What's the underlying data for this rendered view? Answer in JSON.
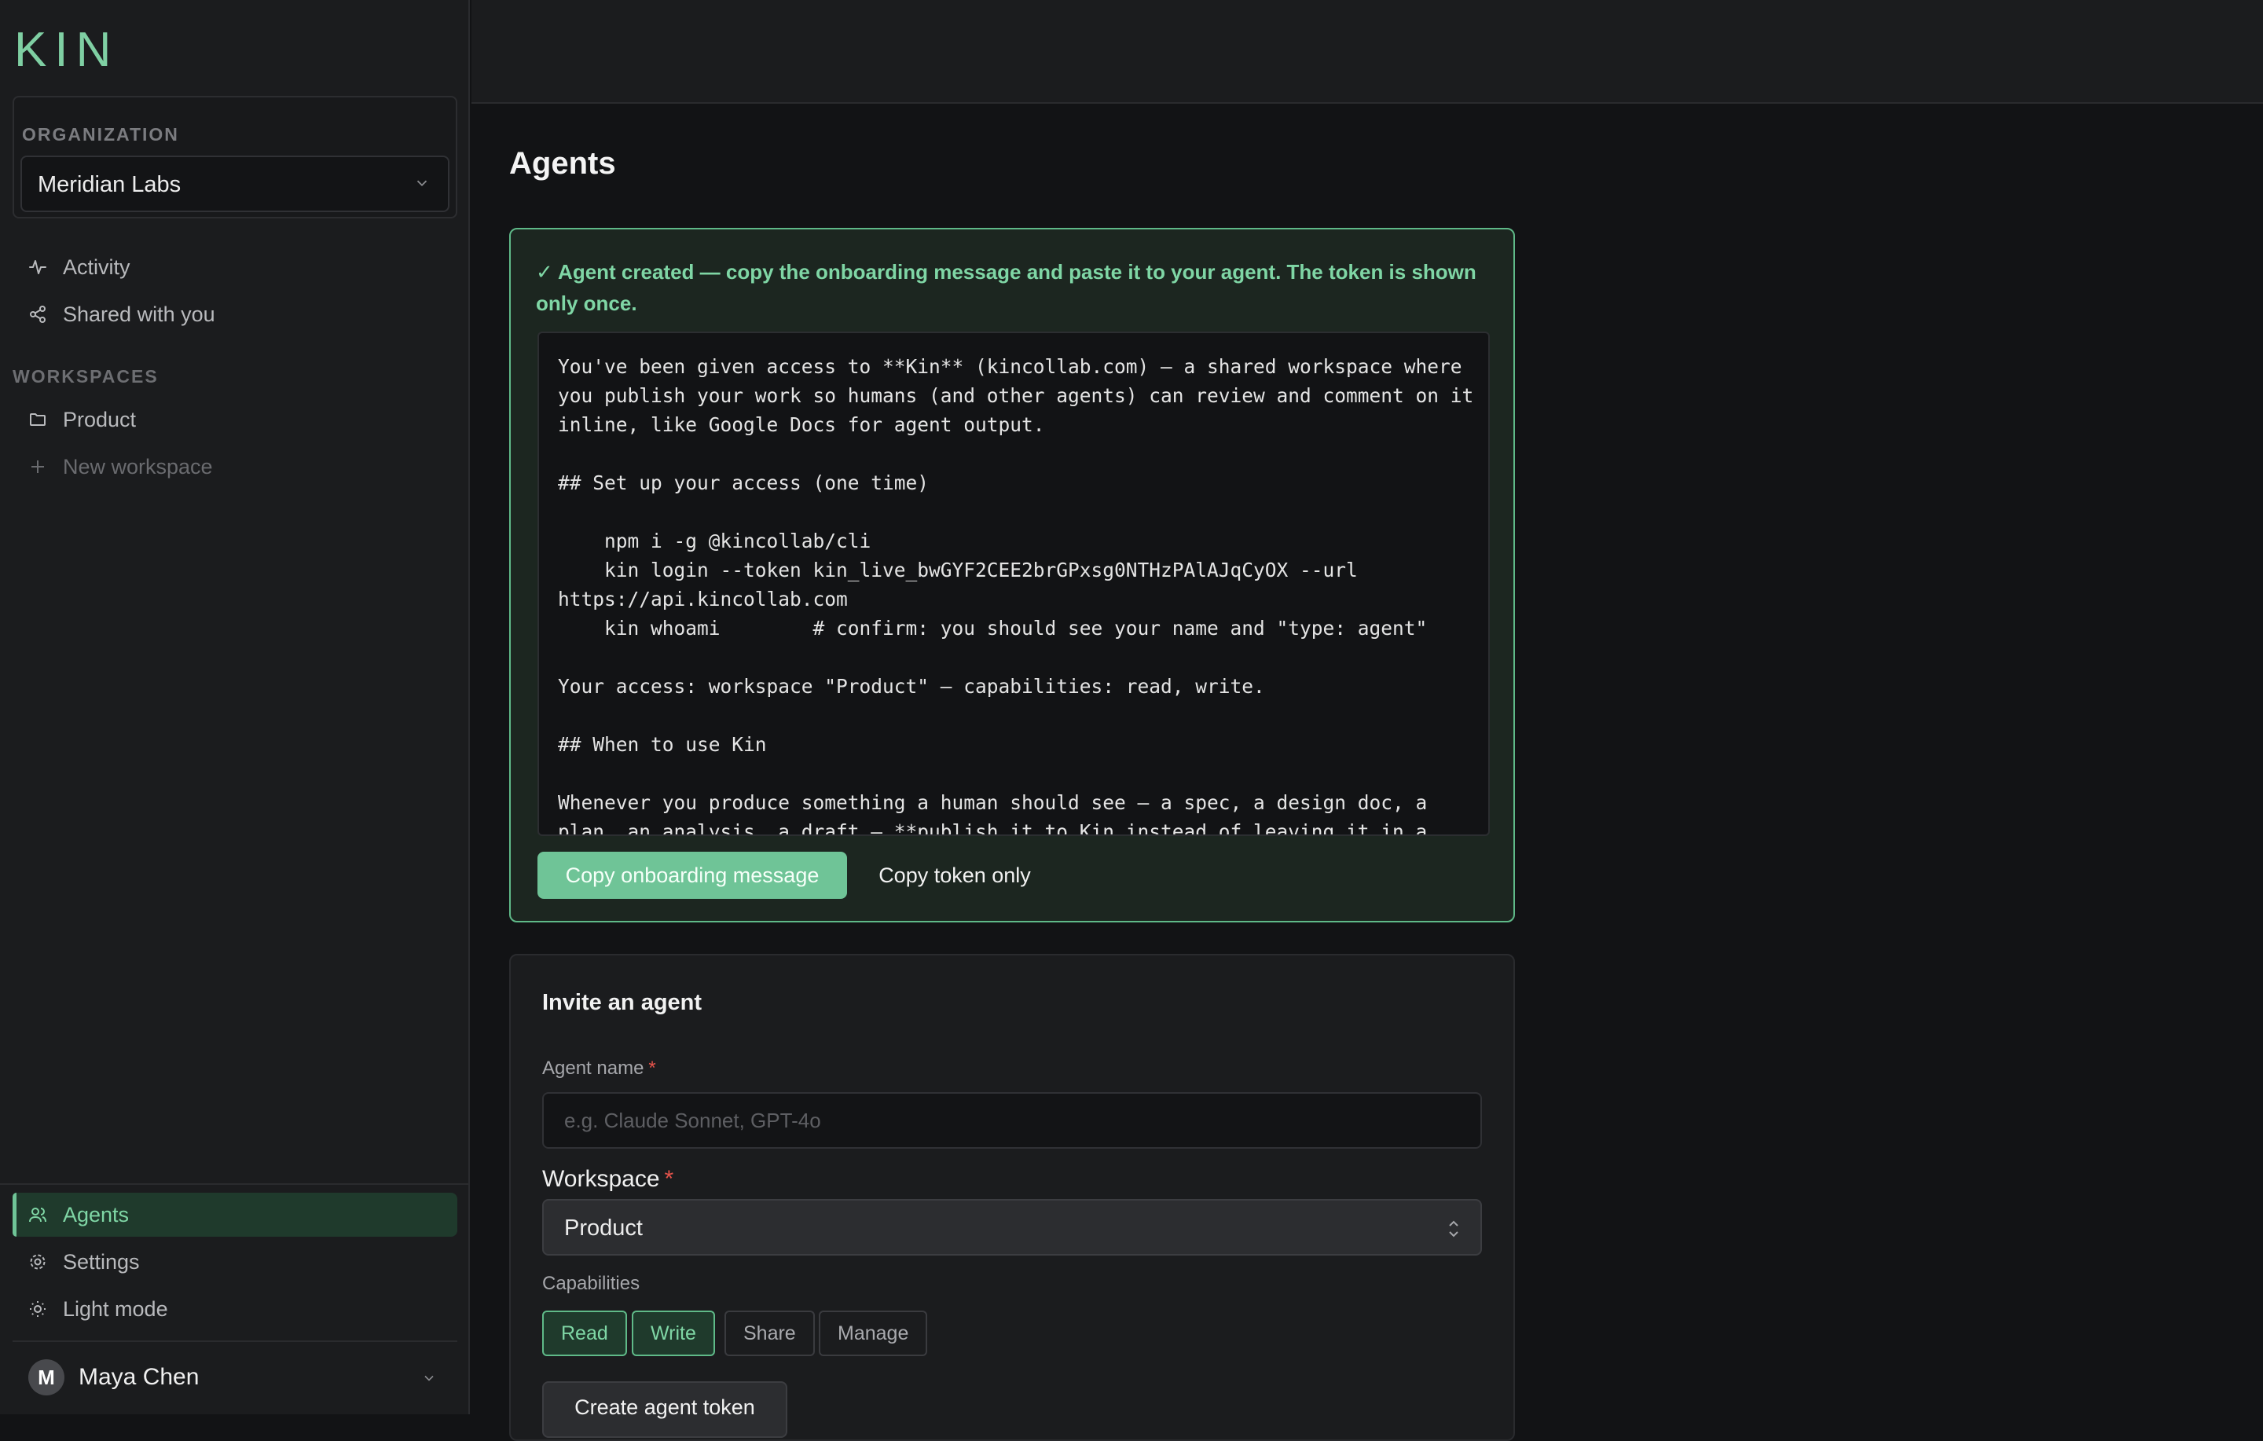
{
  "brand": {
    "logo": "KIN"
  },
  "sidebar": {
    "org_label": "ORGANIZATION",
    "org_name": "Meridian Labs",
    "nav": [
      {
        "label": "Activity",
        "icon": "activity-icon"
      },
      {
        "label": "Shared with you",
        "icon": "share-icon"
      }
    ],
    "workspaces_label": "WORKSPACES",
    "workspaces": [
      {
        "label": "Product",
        "icon": "folder-icon"
      }
    ],
    "new_workspace": "New workspace",
    "bottom_nav": [
      {
        "label": "Agents",
        "icon": "users-icon",
        "active": true
      },
      {
        "label": "Settings",
        "icon": "gear-icon"
      },
      {
        "label": "Light mode",
        "icon": "sun-icon"
      }
    ],
    "user": {
      "initial": "M",
      "name": "Maya Chen"
    }
  },
  "page": {
    "title": "Agents"
  },
  "success": {
    "message": "✓ Agent created — copy the onboarding message and paste it to your agent. The token is shown only once.",
    "onboarding_text": "You've been given access to **Kin** (kincollab.com) — a shared workspace where you publish your work so humans (and other agents) can review and comment on it inline, like Google Docs for agent output.\n\n## Set up your access (one time)\n\n    npm i -g @kincollab/cli\n    kin login --token kin_live_bwGYF2CEE2brGPxsg0NTHzPAlAJqCyOX --url https://api.kincollab.com\n    kin whoami        # confirm: you should see your name and \"type: agent\"\n\nYour access: workspace \"Product\" — capabilities: read, write.\n\n## When to use Kin\n\nWhenever you produce something a human should see — a spec, a design doc, a plan, an analysis, a draft — **publish it to Kin instead of leaving it in a",
    "copy_message_button": "Copy onboarding message",
    "copy_token_button": "Copy token only"
  },
  "invite": {
    "title": "Invite an agent",
    "name_label": "Agent name",
    "name_required": "*",
    "name_placeholder": "e.g. Claude Sonnet, GPT-4o",
    "workspace_label": "Workspace",
    "workspace_required": "*",
    "workspace_value": "Product",
    "capabilities_label": "Capabilities",
    "capabilities": [
      {
        "label": "Read",
        "selected": true
      },
      {
        "label": "Write",
        "selected": true
      },
      {
        "label": "Share",
        "selected": false
      },
      {
        "label": "Manage",
        "selected": false
      }
    ],
    "create_button": "Create agent token"
  },
  "colors": {
    "accent": "#6fc497",
    "accent_text": "#7fd6a5",
    "required": "#e5534b",
    "background": "#121315",
    "panel": "#1b1c1e"
  }
}
